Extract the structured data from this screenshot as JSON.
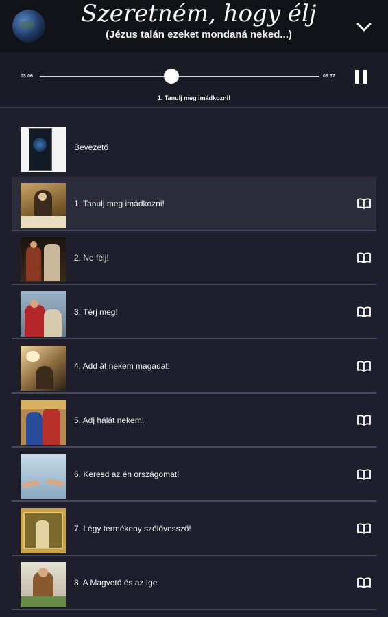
{
  "header": {
    "title": "Szeretném, hogy élj",
    "subtitle": "(Jézus talán ezeket mondaná neked...)"
  },
  "player": {
    "current_time": "03:06",
    "duration": "06:37",
    "progress": 0.47,
    "now_playing": "1. Tanulj meg imádkozni!"
  },
  "tracks": [
    {
      "label": "Bevezető",
      "has_book": false,
      "active": false
    },
    {
      "label": "1. Tanulj meg imádkozni!",
      "has_book": true,
      "active": true
    },
    {
      "label": "2. Ne félj!",
      "has_book": true,
      "active": false
    },
    {
      "label": "3. Térj meg!",
      "has_book": true,
      "active": false
    },
    {
      "label": "4. Add át nekem magadat!",
      "has_book": true,
      "active": false
    },
    {
      "label": "5. Adj hálát nekem!",
      "has_book": true,
      "active": false
    },
    {
      "label": "6. Keresd az én országomat!",
      "has_book": true,
      "active": false
    },
    {
      "label": "7. Légy termékeny szőlővessző!",
      "has_book": true,
      "active": false
    },
    {
      "label": "8. A Magvető és az Ige",
      "has_book": true,
      "active": false
    }
  ],
  "colors": {
    "background": "#1e1e2c",
    "header_bg": "#121219",
    "active_row": "#2c2d3b",
    "divider": "#48495a"
  },
  "icons": {
    "logo": "globe-icon",
    "collapse": "chevron-down-icon",
    "playback": "pause-icon",
    "text": "book-icon"
  }
}
